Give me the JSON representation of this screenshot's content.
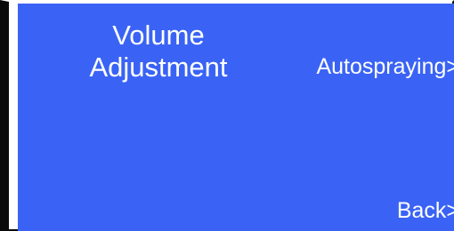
{
  "screen": {
    "title": "Volume\nAdjustment",
    "menu_autospraying": "Autospraying>",
    "menu_back": "Back>"
  },
  "colors": {
    "background": "#3a63f5",
    "text": "#ffffff",
    "frame": "#0a0a0a"
  }
}
